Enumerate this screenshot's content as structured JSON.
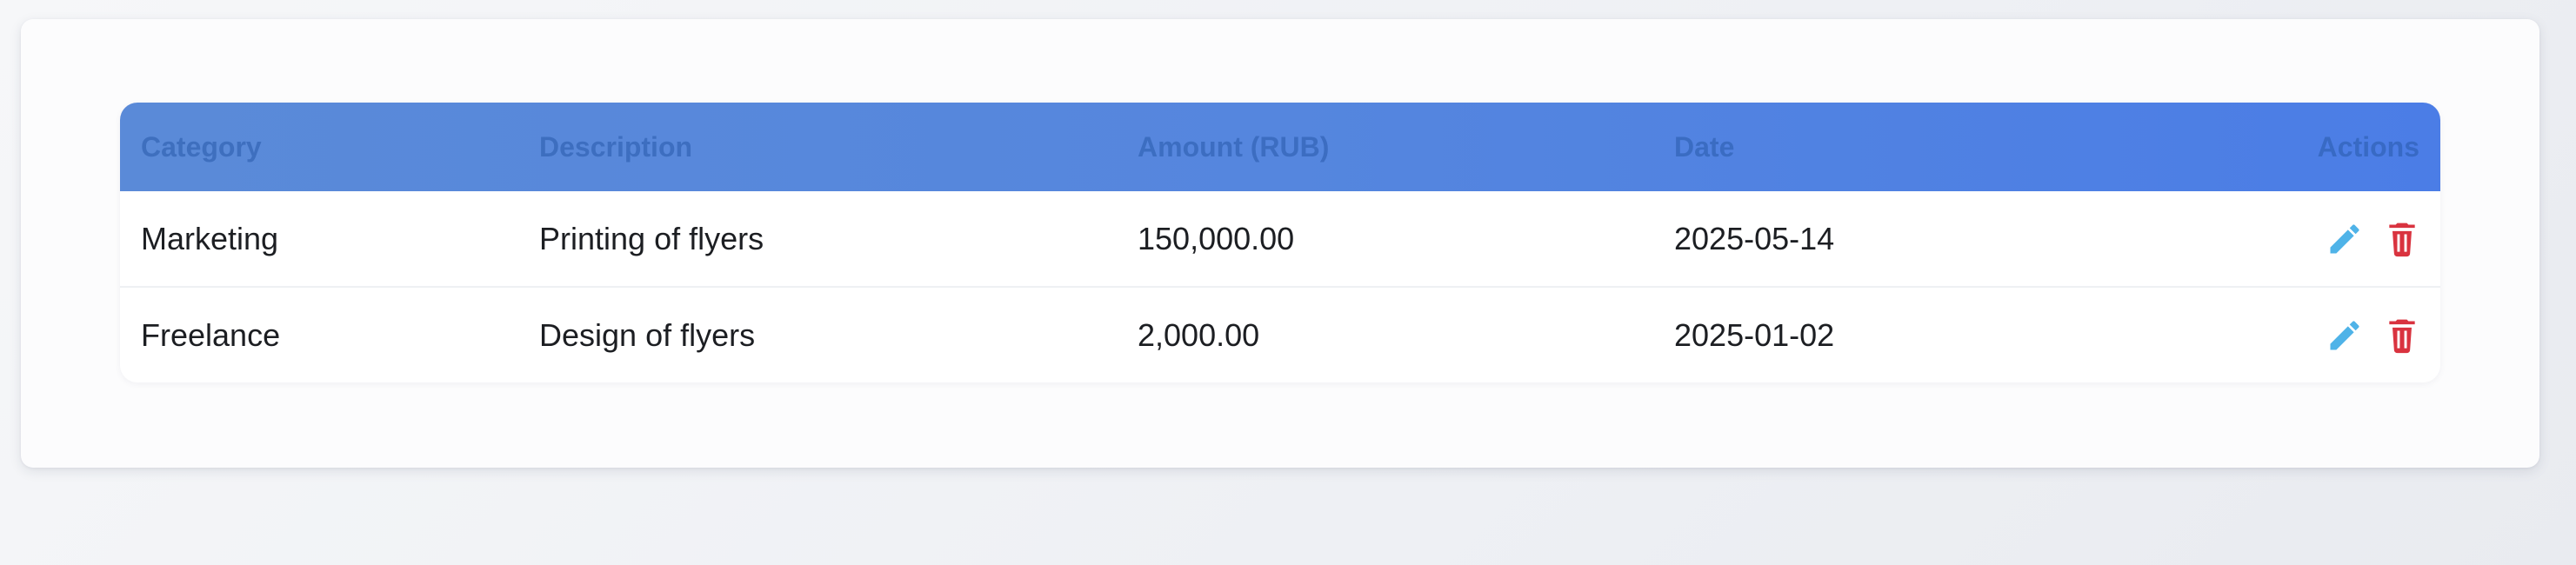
{
  "table": {
    "headers": {
      "category": "Category",
      "description": "Description",
      "amount": "Amount (RUB)",
      "date": "Date",
      "actions": "Actions"
    },
    "rows": [
      {
        "category": "Marketing",
        "description": "Printing of flyers",
        "amount": "150,000.00",
        "date": "2025-05-14",
        "actions": [
          "edit-icon",
          "delete-icon"
        ]
      },
      {
        "category": "Freelance",
        "description": "Design of flyers",
        "amount": "2,000.00",
        "date": "2025-01-02",
        "actions": [
          "edit-icon",
          "delete-icon"
        ]
      }
    ]
  },
  "colors": {
    "header_start": "#5a8ad8",
    "header_end": "#4b7de6",
    "edit_icon": "#4fb3e8",
    "delete_icon": "#d9333f"
  }
}
